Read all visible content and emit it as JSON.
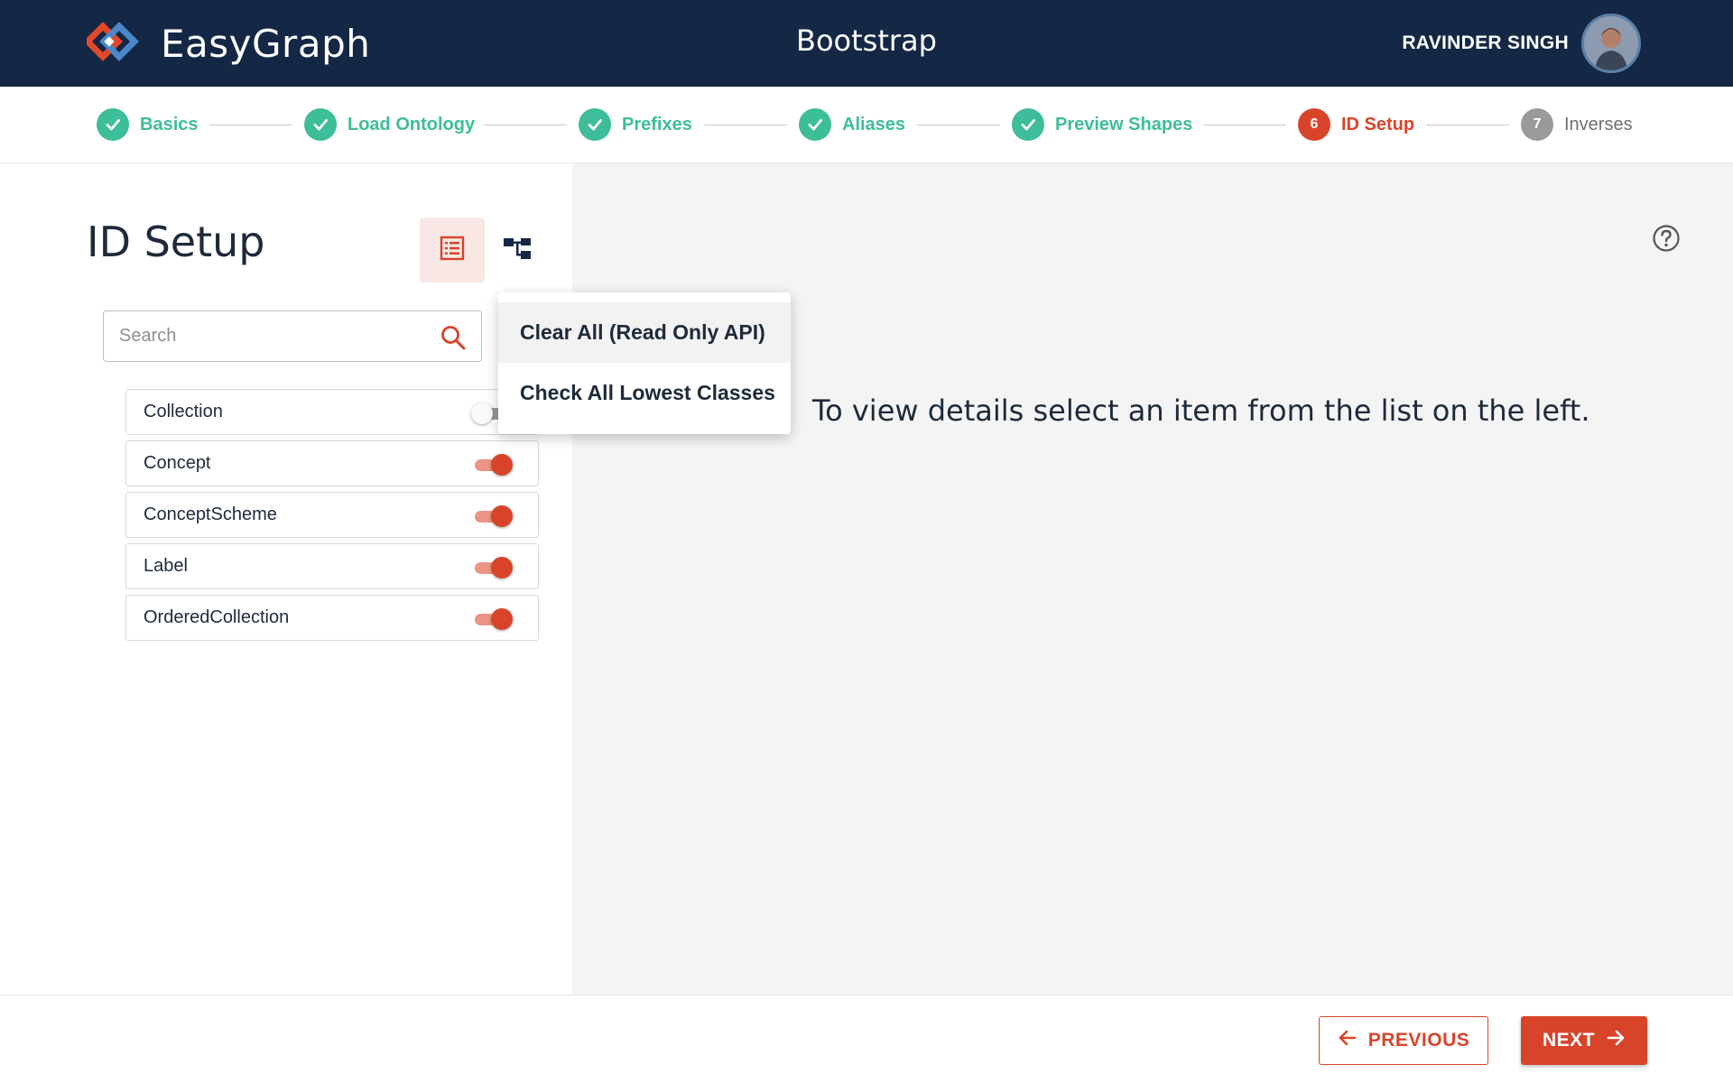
{
  "header": {
    "logo_text": "EasyGraph",
    "app_title": "Bootstrap",
    "user_name": "RAVINDER SINGH"
  },
  "stepper": {
    "steps": [
      {
        "label": "Basics",
        "status": "done"
      },
      {
        "label": "Load Ontology",
        "status": "done"
      },
      {
        "label": "Prefixes",
        "status": "done"
      },
      {
        "label": "Aliases",
        "status": "done"
      },
      {
        "label": "Preview Shapes",
        "status": "done"
      },
      {
        "label": "ID Setup",
        "status": "active",
        "number": "6"
      },
      {
        "label": "Inverses",
        "status": "pending",
        "number": "7"
      }
    ]
  },
  "left": {
    "title": "ID Setup",
    "search_placeholder": "Search",
    "classes": [
      {
        "label": "Collection",
        "enabled": false
      },
      {
        "label": "Concept",
        "enabled": true
      },
      {
        "label": "ConceptScheme",
        "enabled": true
      },
      {
        "label": "Label",
        "enabled": true
      },
      {
        "label": "OrderedCollection",
        "enabled": true
      }
    ]
  },
  "menu": {
    "items": [
      {
        "label": "Clear All (Read Only API)"
      },
      {
        "label": "Check All Lowest Classes"
      }
    ]
  },
  "right": {
    "empty_message": "To view details select an item from the list on the left."
  },
  "footer": {
    "previous_label": "PREVIOUS",
    "next_label": "NEXT"
  },
  "colors": {
    "header_bg": "#142846",
    "accent": "#d8442a",
    "success": "#3dbd99",
    "pending": "#9a9a9a"
  },
  "icons": {
    "logo": "easygraph-logo-icon",
    "list_view": "list-view-icon",
    "tree_view": "tree-view-icon",
    "search": "search-icon",
    "help": "help-icon",
    "check": "check-icon",
    "prev": "arrow-left-icon",
    "next": "arrow-right-icon"
  }
}
